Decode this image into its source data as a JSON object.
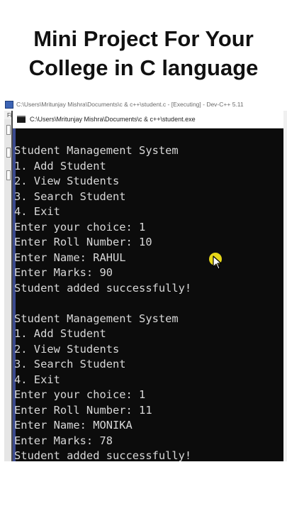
{
  "headline": {
    "line1": "Mini Project For Your",
    "line2": "College in C language"
  },
  "ide": {
    "title": "C:\\Users\\Mritunjay Mishra\\Documents\\c & c++\\student.c - [Executing] - Dev-C++ 5.11",
    "menu_letter": "Fi"
  },
  "console": {
    "title": "C:\\Users\\Mritunjay Mishra\\Documents\\c & c++\\student.exe",
    "lines": [
      "Student Management System",
      "1. Add Student",
      "2. View Students",
      "3. Search Student",
      "4. Exit",
      "Enter your choice: 1",
      "Enter Roll Number: 10",
      "Enter Name: RAHUL",
      "Enter Marks: 90",
      "Student added successfully!",
      "",
      "Student Management System",
      "1. Add Student",
      "2. View Students",
      "3. Search Student",
      "4. Exit",
      "Enter your choice: 1",
      "Enter Roll Number: 11",
      "Enter Name: MONIKA",
      "Enter Marks: 78",
      "Student added successfully!"
    ]
  },
  "colors": {
    "console_bg": "#0c0c0c",
    "console_text": "#d8d8d8",
    "cursor_highlight": "#f2e21a"
  }
}
